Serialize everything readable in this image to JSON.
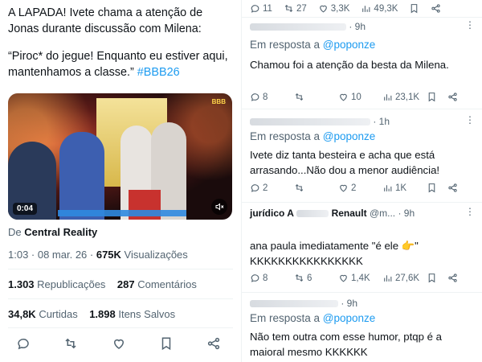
{
  "left": {
    "tweet_line1": "A LAPADA! Ivete chama a atenção de Jonas durante discussão com Milena:",
    "tweet_line2": "“Piroc* do jegue! Enquanto eu estiver aqui, mantenhamos a classe.” ",
    "hashtag": "#BBB26",
    "video_time": "0:04",
    "video_logo": "BBB",
    "source_prefix": "De ",
    "source_name": "Central Reality",
    "time": "1:03 · 08 mar. 26 · ",
    "views_value": "675K",
    "views_label": " Visualizações",
    "reposts_value": "1.303",
    "reposts_label": " Republicações",
    "comments_value": "287",
    "comments_label": " Comentários",
    "likes_value": "34,8K",
    "likes_label": " Curtidas",
    "saves_value": "1.898",
    "saves_label": " Itens Salvos"
  },
  "right": {
    "topbar": {
      "replies": "11",
      "reposts": "27",
      "likes": "3,3K",
      "views": "49,3K"
    },
    "replies": [
      {
        "time": "· 9h",
        "in_reply_prefix": "Em resposta a ",
        "handle": "@poponze",
        "text": "Chamou foi a atenção da besta da Milena.",
        "replies": "8",
        "reposts": "",
        "likes": "10",
        "views": "23,1K"
      },
      {
        "time": "· 1h",
        "in_reply_prefix": "Em resposta a ",
        "handle": "@poponze",
        "text": "Ivete diz tanta besteira e acha que está arrasando...Não dou a menor audiência!",
        "replies": "2",
        "reposts": "",
        "likes": "2",
        "views": "1K"
      },
      {
        "name": "jurídico A",
        "name_extra": "Renault",
        "time": "@m... · 9h",
        "in_reply_prefix": "",
        "handle": "",
        "text": "ana paula imediatamente \"é ele 👉\" KKKKKKKKKKKKKKKK",
        "replies": "8",
        "reposts": "6",
        "likes": "1,4K",
        "views": "27,6K"
      },
      {
        "time": "· 9h",
        "in_reply_prefix": "Em resposta a ",
        "handle": "@poponze",
        "text": "Não tem outra com esse humor, ptqp é a maioral mesmo KKKKKK"
      }
    ]
  },
  "icons": {
    "reply": "reply-icon",
    "repost": "repost-icon",
    "like": "heart-icon",
    "views": "views-icon",
    "bookmark": "bookmark-icon",
    "share": "share-icon",
    "more": "more-icon",
    "volume": "volume-icon"
  },
  "colors": {
    "accent": "#1d9bf0",
    "muted": "#536471",
    "text": "#0f1419"
  }
}
